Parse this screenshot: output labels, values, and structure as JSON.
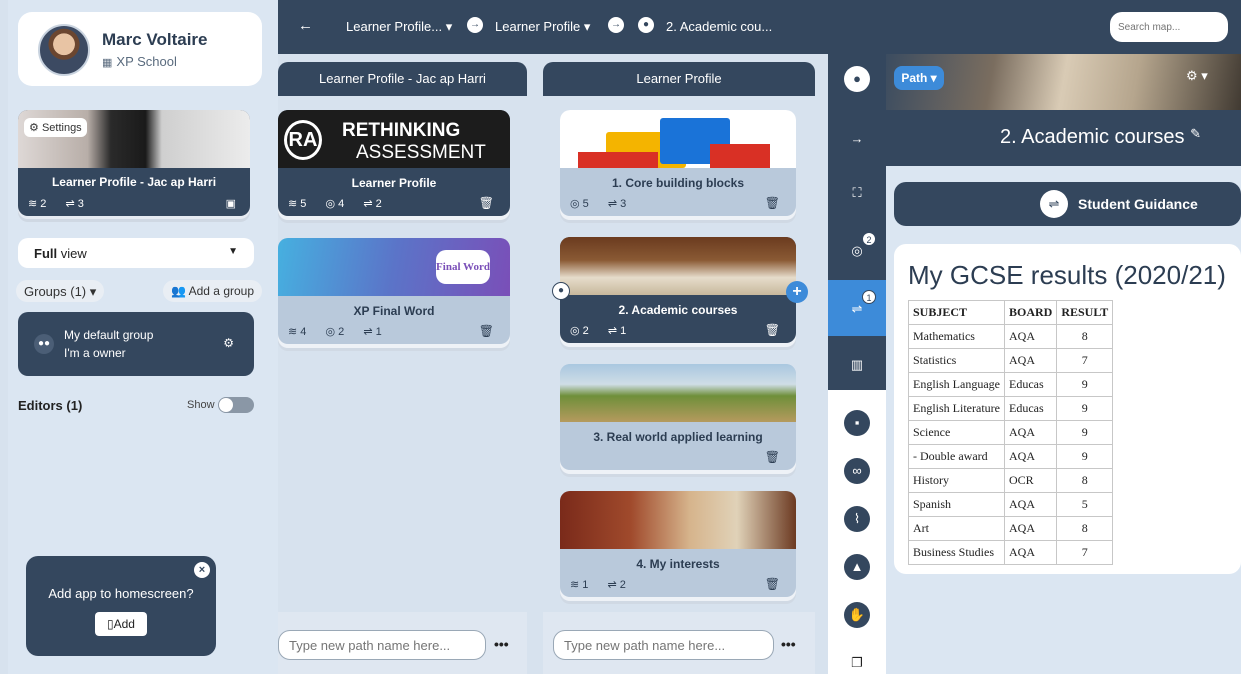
{
  "profile": {
    "name": "Marc Voltaire",
    "school": "XP School"
  },
  "profile_card": {
    "settings": "Settings",
    "title": "Learner Profile - Jac ap Harri",
    "stat1": "2",
    "stat2": "3"
  },
  "view": {
    "label": "Full",
    "suffix": "view"
  },
  "groups": {
    "label": "Groups (1)",
    "add": "Add a group",
    "name": "My default group",
    "role": "I'm a owner"
  },
  "editors": {
    "label": "Editors (1)",
    "show": "Show"
  },
  "homescreen": {
    "message": "Add app to homescreen?",
    "add": "Add"
  },
  "topbar": {
    "crumb1": "Learner Profile...",
    "crumb2": "Learner Profile",
    "crumb3": "2. Academic cou...",
    "search_placeholder": "Search map..."
  },
  "col1": {
    "header": "Learner Profile - Jac ap Harri",
    "cards": [
      {
        "title": "Learner Profile",
        "img_text1": "RETHINKING",
        "img_text2": "ASSESSMENT",
        "s1": "5",
        "s2": "4",
        "s3": "2"
      },
      {
        "title": "XP Final Word",
        "img_text": "Final Word",
        "s1": "4",
        "s2": "2",
        "s3": "1"
      }
    ],
    "placeholder": "Type new path name here..."
  },
  "col2": {
    "header": "Learner Profile",
    "cards": [
      {
        "title": "1. Core building blocks",
        "s1": "5",
        "s2": "3"
      },
      {
        "title": "2. Academic courses",
        "s1": "2",
        "s2": "1"
      },
      {
        "title": "3. Real world applied learning"
      },
      {
        "title": "4. My interests",
        "s1": "1",
        "s2": "2"
      }
    ],
    "placeholder": "Type new path name here..."
  },
  "strip": {
    "badge_a": "2",
    "badge_b": "1"
  },
  "right": {
    "path": "Path",
    "title": "2. Academic courses",
    "guidance": "Student Guidance",
    "gcse_title": "My GCSE results (2020/21)",
    "table_headers": [
      "SUBJECT",
      "BOARD",
      "RESULT"
    ],
    "rows": [
      [
        "Mathematics",
        "AQA",
        "8"
      ],
      [
        "Statistics",
        "AQA",
        "7"
      ],
      [
        "English Language",
        "Educas",
        "9"
      ],
      [
        "English Literature",
        "Educas",
        "9"
      ],
      [
        "Science",
        "AQA",
        "9"
      ],
      [
        "- Double award",
        "AQA",
        "9"
      ],
      [
        "History",
        "OCR",
        "8"
      ],
      [
        "Spanish",
        "AQA",
        "5"
      ],
      [
        "Art",
        "AQA",
        "8"
      ],
      [
        "Business Studies",
        "AQA",
        "7"
      ]
    ]
  },
  "colors": {
    "navy": "#34475e",
    "blue": "#3d8bd9",
    "bg": "#d7e2ee"
  }
}
